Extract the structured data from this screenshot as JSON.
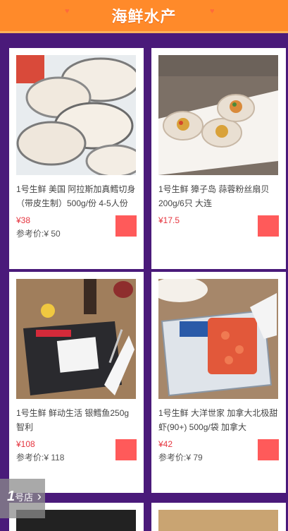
{
  "header": {
    "title": "海鲜水产"
  },
  "products": [
    {
      "name": "1号生鲜 美国 阿拉斯加真鳕切身（带皮生制）500g/份 4-5人份",
      "price": "¥38",
      "ref": "参考价:¥ 50"
    },
    {
      "name": "1号生鲜 獐子岛 蒜蓉粉丝扇贝 200g/6只 大连",
      "price": "¥17.5",
      "ref": ""
    },
    {
      "name": "1号生鲜 鲜动生活 银鳕鱼250g 智利",
      "price": "¥108",
      "ref": "参考价:¥ 118"
    },
    {
      "name": "1号生鲜 大洋世家 加拿大北极甜虾(90+) 500g/袋 加拿大",
      "price": "¥42",
      "ref": "参考价:¥ 79"
    }
  ],
  "float_logo": {
    "num": "1",
    "text": "号店",
    "arrow": "›"
  },
  "colors": {
    "header": "#ff8a2a",
    "background": "#4a1a7a",
    "price": "#e5343e",
    "cart": "#ff5a5a"
  }
}
